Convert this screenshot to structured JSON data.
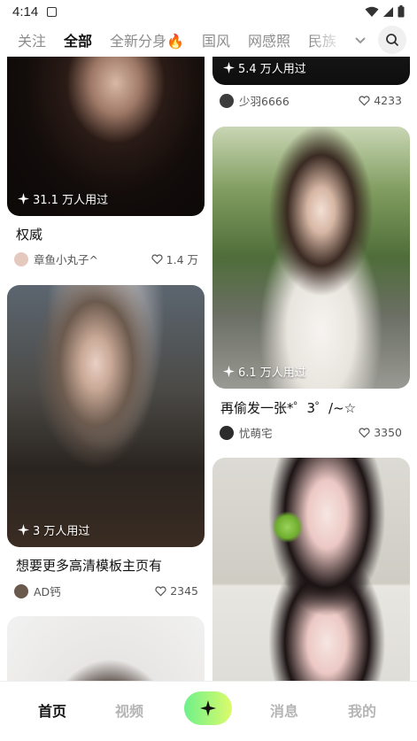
{
  "status": {
    "time": "4:14"
  },
  "tabs": [
    {
      "label": "关注"
    },
    {
      "label": "全部"
    },
    {
      "label": "全新分身🔥"
    },
    {
      "label": "国风"
    },
    {
      "label": "网感照"
    },
    {
      "label": "民族"
    }
  ],
  "feed": {
    "cards": [
      {
        "used": "31.1 万人用过",
        "title": "权威",
        "author": "章鱼小丸子^",
        "likes": "1.4 万"
      },
      {
        "used": "3 万人用过",
        "title": "想要更多高清模板主页有",
        "author": "AD钙",
        "likes": "2345"
      },
      {
        "used": "5.4 万人用过",
        "title": "",
        "author": "少羽6666",
        "likes": "4233"
      },
      {
        "used": "6.1 万人用过",
        "title": "再偷发一张*゜3゜/~☆",
        "author": "忧萌宅",
        "likes": "3350"
      }
    ]
  },
  "nav": {
    "home": "首页",
    "video": "视频",
    "messages": "消息",
    "mine": "我的"
  },
  "colors": {
    "accent": "#c6f56a",
    "create_gradient_start": "#6ef08b",
    "create_gradient_end": "#dcfb6a"
  },
  "icons": [
    "signal-icon",
    "wifi-icon",
    "battery-icon",
    "chevron-down-icon",
    "search-icon",
    "sparkle-icon",
    "heart-icon"
  ]
}
